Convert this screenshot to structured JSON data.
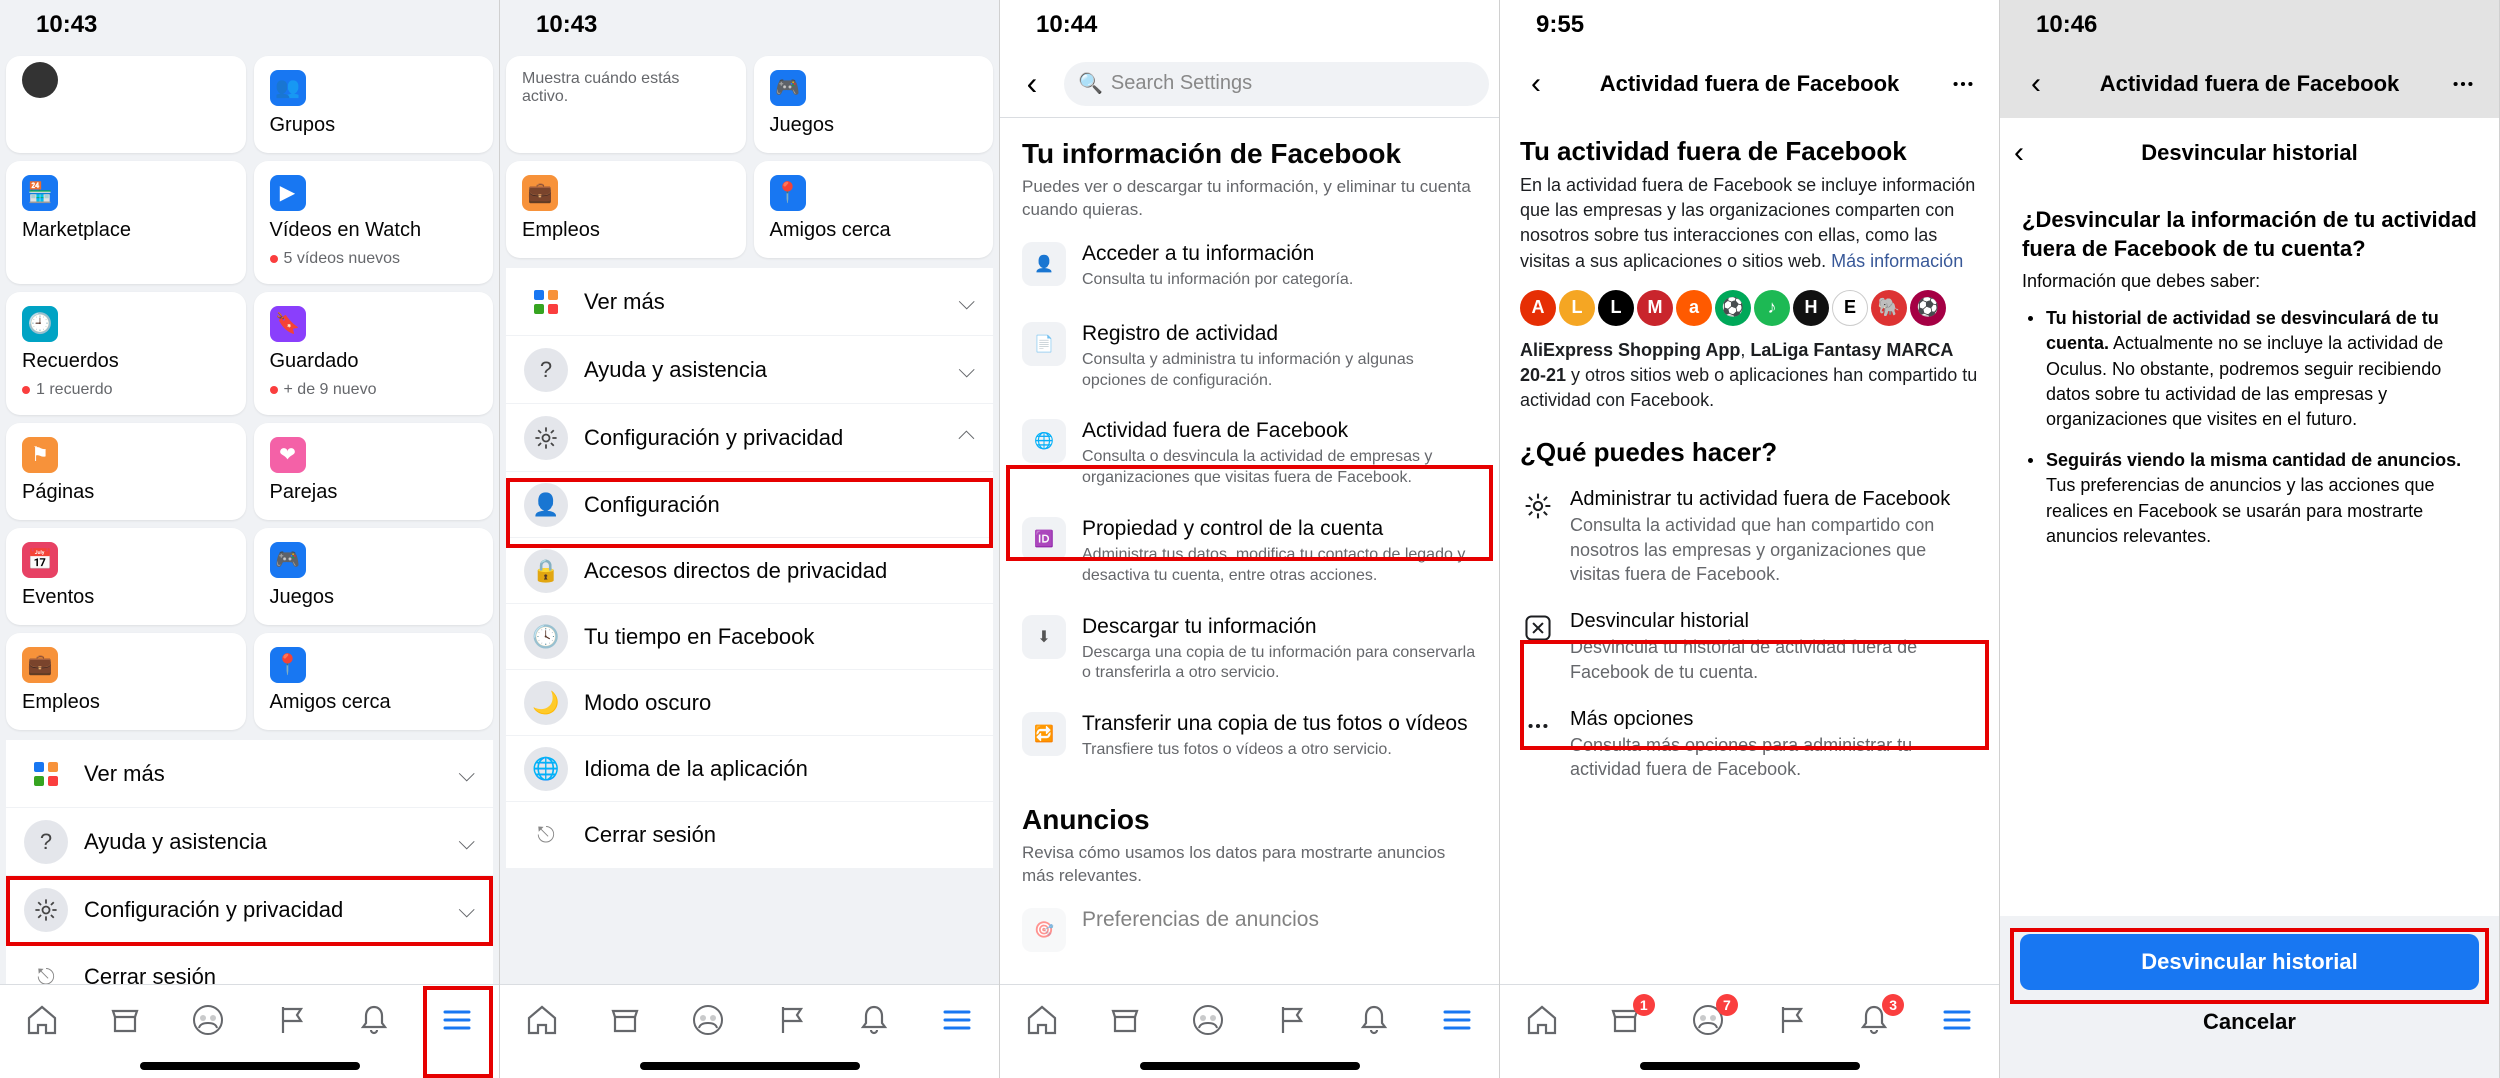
{
  "screens": {
    "s1": {
      "time": "10:43",
      "tiles": {
        "marketplace": "Marketplace",
        "recuerdos": "Recuerdos",
        "recuerdos_sub": "1 recuerdo",
        "paginas": "Páginas",
        "eventos": "Eventos",
        "empleos": "Empleos",
        "grupos": "Grupos",
        "videos": "Vídeos en Watch",
        "videos_sub": "5 vídeos nuevos",
        "guardado": "Guardado",
        "guardado_sub": "+ de 9 nuevo",
        "parejas": "Parejas",
        "juegos": "Juegos",
        "amigos_cerca": "Amigos cerca"
      },
      "rows": {
        "vermas": "Ver más",
        "ayuda": "Ayuda y asistencia",
        "config": "Configuración y privacidad",
        "logout": "Cerrar sesión"
      }
    },
    "s2": {
      "time": "10:43",
      "tiles": {
        "eventos_top_sub": "Muestra cuándo estás activo.",
        "empleos": "Empleos",
        "juegos": "Juegos",
        "amigos_cerca": "Amigos cerca"
      },
      "rows": {
        "vermas": "Ver más",
        "ayuda": "Ayuda y asistencia",
        "config": "Configuración y privacidad",
        "configuracion": "Configuración",
        "accesos": "Accesos directos de privacidad",
        "tu_tiempo": "Tu tiempo en Facebook",
        "modo_oscuro": "Modo oscuro",
        "idioma": "Idioma de la aplicación",
        "logout": "Cerrar sesión"
      }
    },
    "s3": {
      "time": "10:44",
      "search_placeholder": "Search Settings",
      "section_title": "Tu información de Facebook",
      "section_sub": "Puedes ver o descargar tu información, y eliminar tu cuenta cuando quieras.",
      "items": [
        {
          "title": "Acceder a tu información",
          "sub": "Consulta tu información por categoría."
        },
        {
          "title": "Registro de actividad",
          "sub": "Consulta y administra tu información y algunas opciones de configuración."
        },
        {
          "title": "Actividad fuera de Facebook",
          "sub": "Consulta o desvincula la actividad de empresas y organizaciones que visitas fuera de Facebook."
        },
        {
          "title": "Propiedad y control de la cuenta",
          "sub": "Administra tus datos, modifica tu contacto de legado y desactiva tu cuenta, entre otras acciones."
        },
        {
          "title": "Descargar tu información",
          "sub": "Descarga una copia de tu información para conservarla o transferirla a otro servicio."
        },
        {
          "title": "Transferir una copia de tus fotos o vídeos",
          "sub": "Transfiere tus fotos o vídeos a otro servicio."
        }
      ],
      "section2_title": "Anuncios",
      "section2_sub": "Revisa cómo usamos los datos para mostrarte anuncios más relevantes.",
      "pref_row": "Preferencias de anuncios"
    },
    "s4": {
      "time": "9:55",
      "header": "Actividad fuera de Facebook",
      "h1": "Tu actividad fuera de Facebook",
      "para": "En la actividad fuera de Facebook se incluye información que las empresas y las organizaciones comparten con nosotros sobre tus interacciones con ellas, como las visitas a sus aplicaciones o sitios web.",
      "mas": "Más información",
      "apps_line1": "AliExpress Shopping App",
      "apps_comma": ", ",
      "apps_line2": "LaLiga Fantasy MARCA 20-21",
      "apps_tail": " y otros sitios web o aplicaciones han compartido tu actividad con Facebook.",
      "h2": "¿Qué puedes hacer?",
      "opts": [
        {
          "title": "Administrar tu actividad fuera de Facebook",
          "sub": "Consulta la actividad que han compartido con nosotros las empresas y organizaciones que visitas fuera de Facebook."
        },
        {
          "title": "Desvincular historial",
          "sub": "Desvincula tu historial de actividad fuera de Facebook de tu cuenta."
        },
        {
          "title": "Más opciones",
          "sub": "Consulta más opciones para administrar tu actividad fuera de Facebook."
        }
      ],
      "badges": {
        "market": "1",
        "groups": "7",
        "bell": "3"
      }
    },
    "s5": {
      "time": "10:46",
      "header": "Actividad fuera de Facebook",
      "sub_header": "Desvincular historial",
      "q": "¿Desvincular la información de tu actividad fuera de Facebook de tu cuenta?",
      "intro": "Información que debes saber:",
      "b1_bold": "Tu historial de actividad se desvinculará de tu cuenta.",
      "b1_rest": " Actualmente no se incluye la actividad de Oculus. No obstante, podremos seguir recibiendo datos sobre tu actividad de las empresas y organizaciones que visites en el futuro.",
      "b2_bold": "Seguirás viendo la misma cantidad de anuncios.",
      "b2_rest": " Tus preferencias de anuncios y las acciones que realices en Facebook se usarán para mostrarte anuncios relevantes.",
      "primary": "Desvincular historial",
      "cancel": "Cancelar"
    }
  }
}
